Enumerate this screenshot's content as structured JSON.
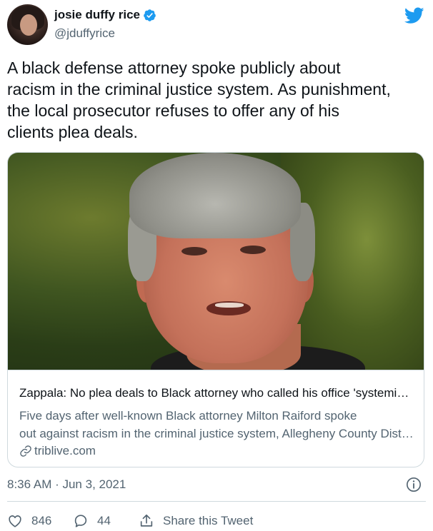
{
  "author": {
    "display_name": "josie duffy rice",
    "handle": "@jduffyrice",
    "verified": true
  },
  "tweet": {
    "text": "A black defense attorney spoke publicly about\nracism in the criminal justice system. As punishment,\nthe local prosecutor refuses to offer any of his\nclients plea deals."
  },
  "link_card": {
    "title": "Zappala: No plea deals to Black attorney who called his office 'systemically racist'",
    "description_line1": "Five days after well-known Black attorney Milton Raiford spoke",
    "description_line2": "out against racism in the criminal justice system, Allegheny County District Attorney",
    "domain": "triblive.com"
  },
  "meta": {
    "timestamp": "8:36 AM · Jun 3, 2021"
  },
  "actions": {
    "like_count": "846",
    "reply_count": "44",
    "share_label": "Share this Tweet"
  },
  "colors": {
    "accent": "#1d9bf0",
    "secondary_text": "#536471",
    "border": "#cfd9de"
  },
  "icons": [
    "verified-badge-icon",
    "twitter-bird-icon",
    "link-icon",
    "info-icon",
    "heart-icon",
    "reply-bubble-icon",
    "share-icon"
  ]
}
